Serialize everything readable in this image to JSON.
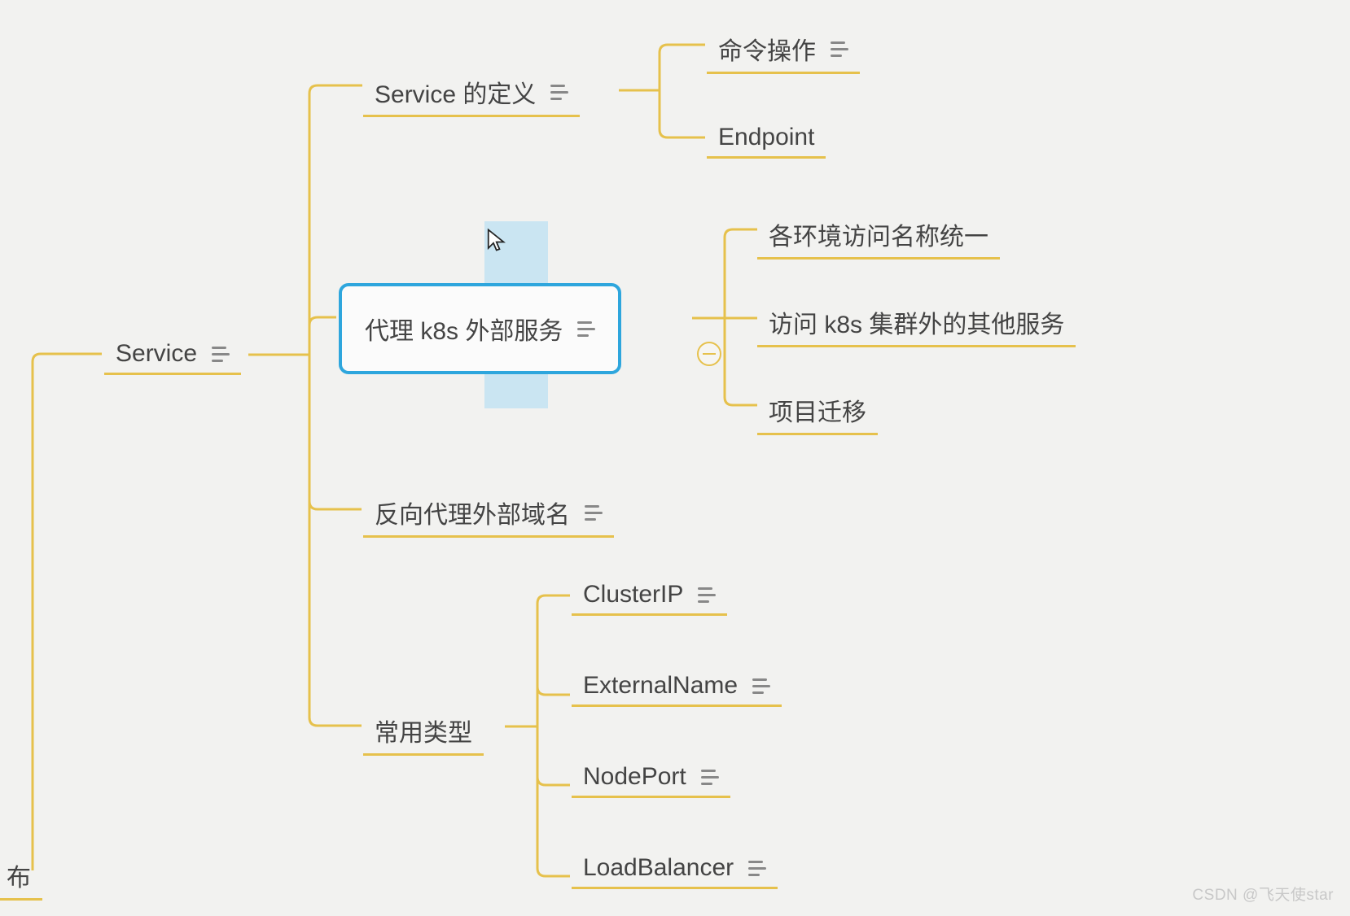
{
  "root_partial": "布",
  "level1": {
    "label": "Service"
  },
  "branches": {
    "definition": {
      "label": "Service 的定义",
      "children": {
        "cmd": "命令操作",
        "endpoint": "Endpoint"
      }
    },
    "proxy_k8s": {
      "label": "代理 k8s 外部服务",
      "children": {
        "env_names": "各环境访问名称统一",
        "other_svc": "访问 k8s 集群外的其他服务",
        "migrate": "项目迁移"
      }
    },
    "reverse_proxy": {
      "label": "反向代理外部域名"
    },
    "types": {
      "label": "常用类型",
      "children": {
        "clusterip": "ClusterIP",
        "externalname": "ExternalName",
        "nodeport": "NodePort",
        "loadbalancer": "LoadBalancer"
      }
    }
  },
  "watermark": "CSDN @飞天使star",
  "colors": {
    "line": "#e6c14c",
    "selected": "#2ea6dd",
    "highlight": "#bfe1f3"
  }
}
